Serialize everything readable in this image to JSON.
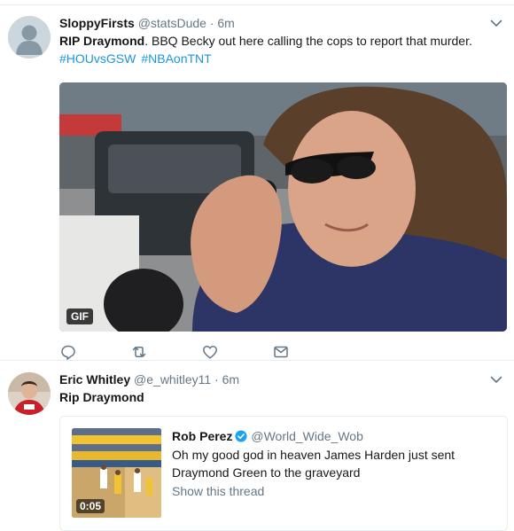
{
  "tweets": [
    {
      "fullname": "SloppyFirsts",
      "handle": "@statsDude",
      "separator": "·",
      "time": "6m",
      "text_bold": "RIP Draymond",
      "text_rest": ".  BBQ Becky out here calling the cops to report that murder.",
      "hashtags": [
        "#HOUvsGSW",
        "#NBAonTNT"
      ],
      "media_badge": "GIF",
      "actions": [
        "reply-icon",
        "retweet-icon",
        "like-icon",
        "direct-message-icon"
      ]
    },
    {
      "fullname": "Eric Whitley",
      "handle": "@e_whitley11",
      "separator": "·",
      "time": "6m",
      "text": "Rip Draymond",
      "quote": {
        "fullname": "Rob Perez",
        "handle": "@World_Wide_Wob",
        "text": "Oh my good god in heaven James Harden just sent Draymond Green to the graveyard",
        "show_thread": "Show this thread",
        "video_duration": "0:05"
      }
    }
  ],
  "colors": {
    "link": "#1b95e0",
    "muted": "#657786",
    "text": "#14171a",
    "divider": "#e6ecf0",
    "verified": "#1da1f2"
  }
}
